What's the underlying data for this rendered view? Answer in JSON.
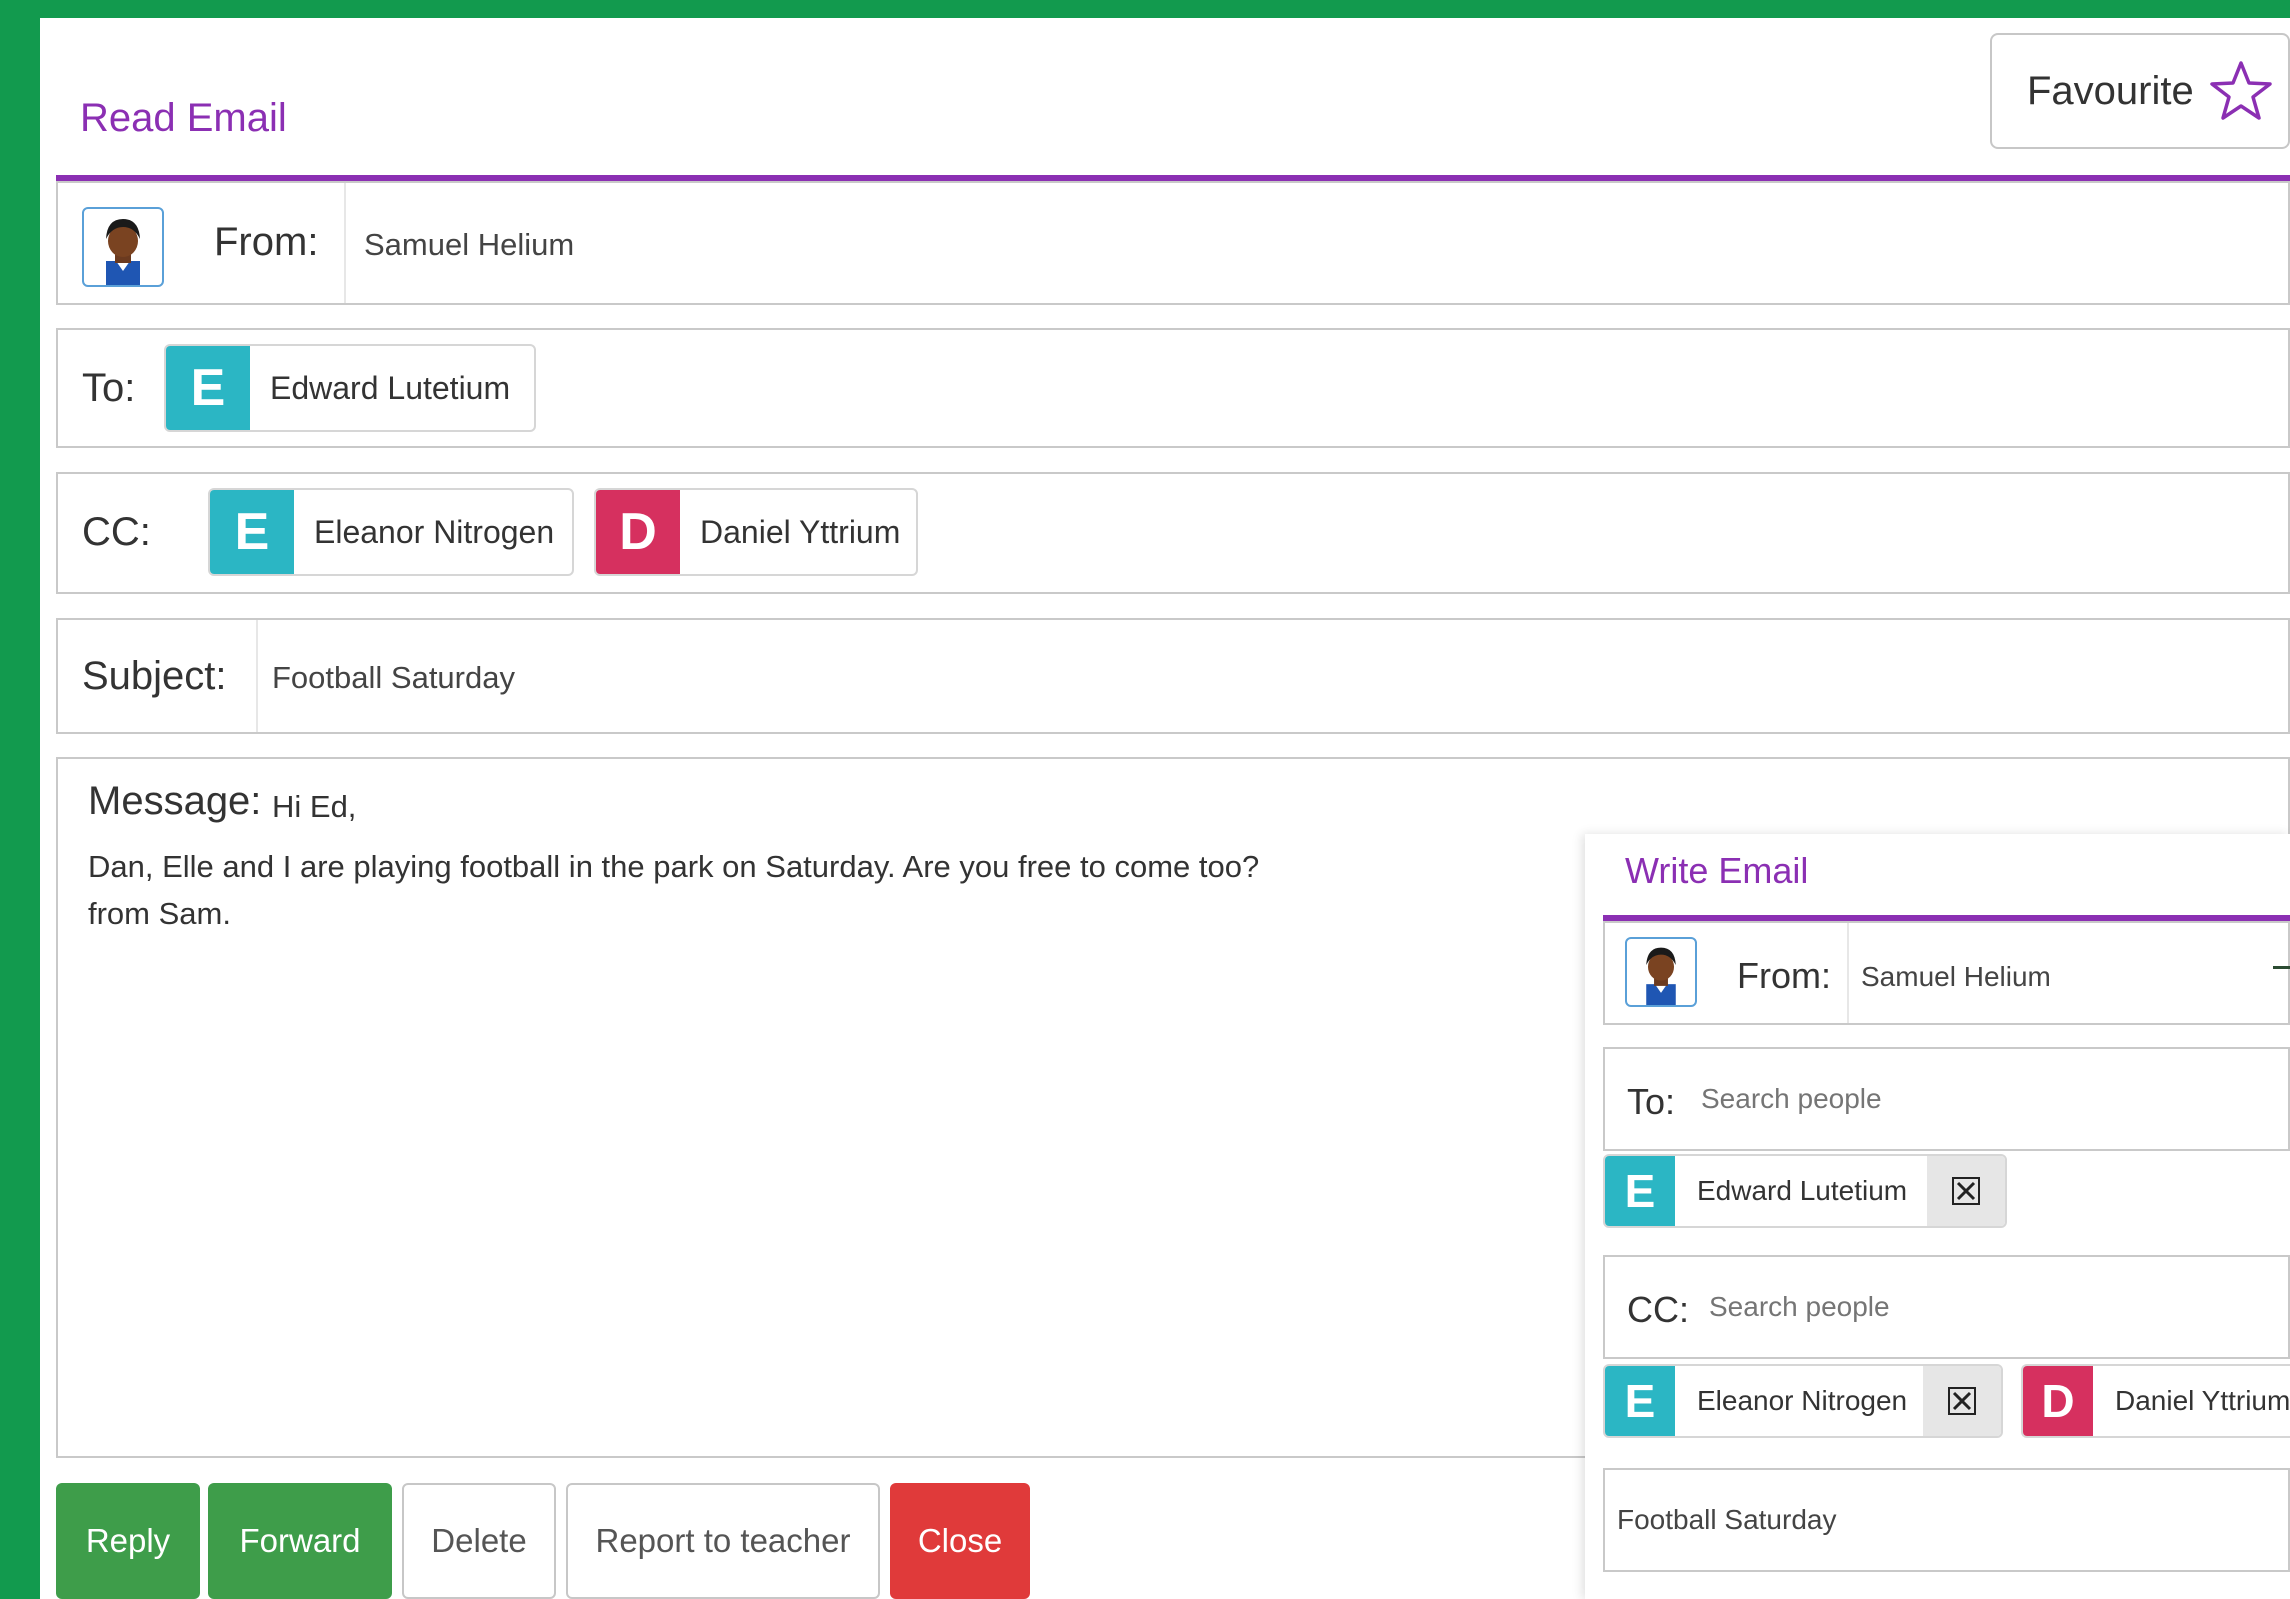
{
  "colors": {
    "background": "#129a4e",
    "accent_purple": "#8b2fb3",
    "green_button": "#3e9d4a",
    "red_button": "#e03a3a",
    "teal_avatar": "#2bb6c4",
    "crimson_avatar": "#d6305f"
  },
  "read": {
    "title": "Read Email",
    "favourite_label": "Favourite",
    "from_label": "From:",
    "from_name": "Samuel Helium",
    "to_label": "To:",
    "to": [
      {
        "initial": "E",
        "name": "Edward Lutetium",
        "color": "teal"
      }
    ],
    "cc_label": "CC:",
    "cc": [
      {
        "initial": "E",
        "name": "Eleanor Nitrogen",
        "color": "teal"
      },
      {
        "initial": "D",
        "name": "Daniel Yttrium",
        "color": "crimson"
      }
    ],
    "subject_label": "Subject:",
    "subject": "Football Saturday",
    "message_label": "Message:",
    "message_greeting": "Hi Ed,",
    "message_lines": [
      "Dan, Elle and I are playing football in the park on Saturday. Are you free to come too?",
      "from Sam."
    ],
    "buttons": {
      "reply": "Reply",
      "forward": "Forward",
      "delete": "Delete",
      "report": "Report to teacher",
      "close": "Close"
    }
  },
  "write": {
    "title": "Write Email",
    "from_label": "From:",
    "from_name": "Samuel Helium",
    "to_label": "To:",
    "to_placeholder": "Search people",
    "to_chips": [
      {
        "initial": "E",
        "name": "Edward Lutetium"
      }
    ],
    "cc_label": "CC:",
    "cc_placeholder": "Search people",
    "cc_chips": [
      {
        "initial": "E",
        "name": "Eleanor Nitrogen"
      },
      {
        "initial": "D",
        "name": "Daniel Yttrium"
      }
    ],
    "subject_value": "Football Saturday"
  },
  "icons": {
    "favourite": "star-outline-icon",
    "avatar": "student-avatar-icon",
    "remove": "close-x-icon"
  }
}
